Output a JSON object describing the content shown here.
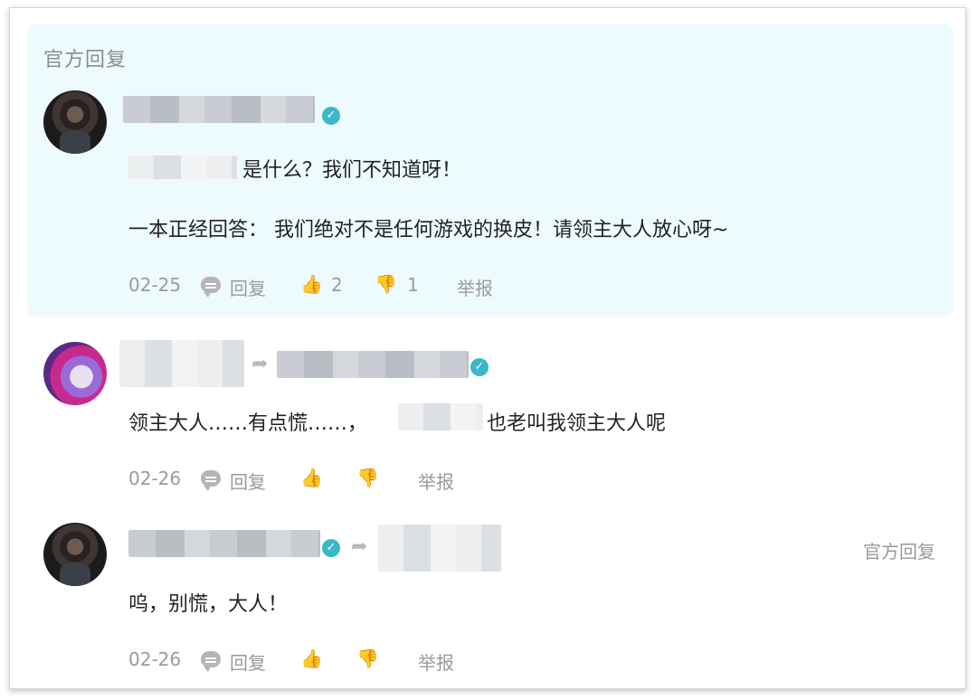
{
  "section_label": "官方回复",
  "comments": [
    {
      "text_line1_suffix": "是什么？我们不知道呀！",
      "text_line2": "一本正经回答： 我们绝对不是任何游戏的换皮！请领主大人放心呀~",
      "date": "02-25",
      "reply_label": "回复",
      "like_count": "2",
      "dislike_count": "1",
      "report_label": "举报"
    },
    {
      "text_prefix": "领主大人……有点慌……，",
      "text_suffix": "也老叫我领主大人呢",
      "date": "02-26",
      "reply_label": "回复",
      "report_label": "举报"
    },
    {
      "official_tag": "官方回复",
      "text": "呜，别慌，大人！",
      "date": "02-26",
      "reply_label": "回复",
      "report_label": "举报"
    }
  ],
  "icons": {
    "verified": "verified-check-icon",
    "reply": "speech-bubble-icon",
    "like": "thumbs-up-icon",
    "dislike": "thumbs-down-icon",
    "reply_arrow": "reply-arrow-icon"
  },
  "colors": {
    "official_bg": "#eefbfe",
    "verified": "#3bb7c9",
    "meta_text": "#9a9a9a"
  }
}
